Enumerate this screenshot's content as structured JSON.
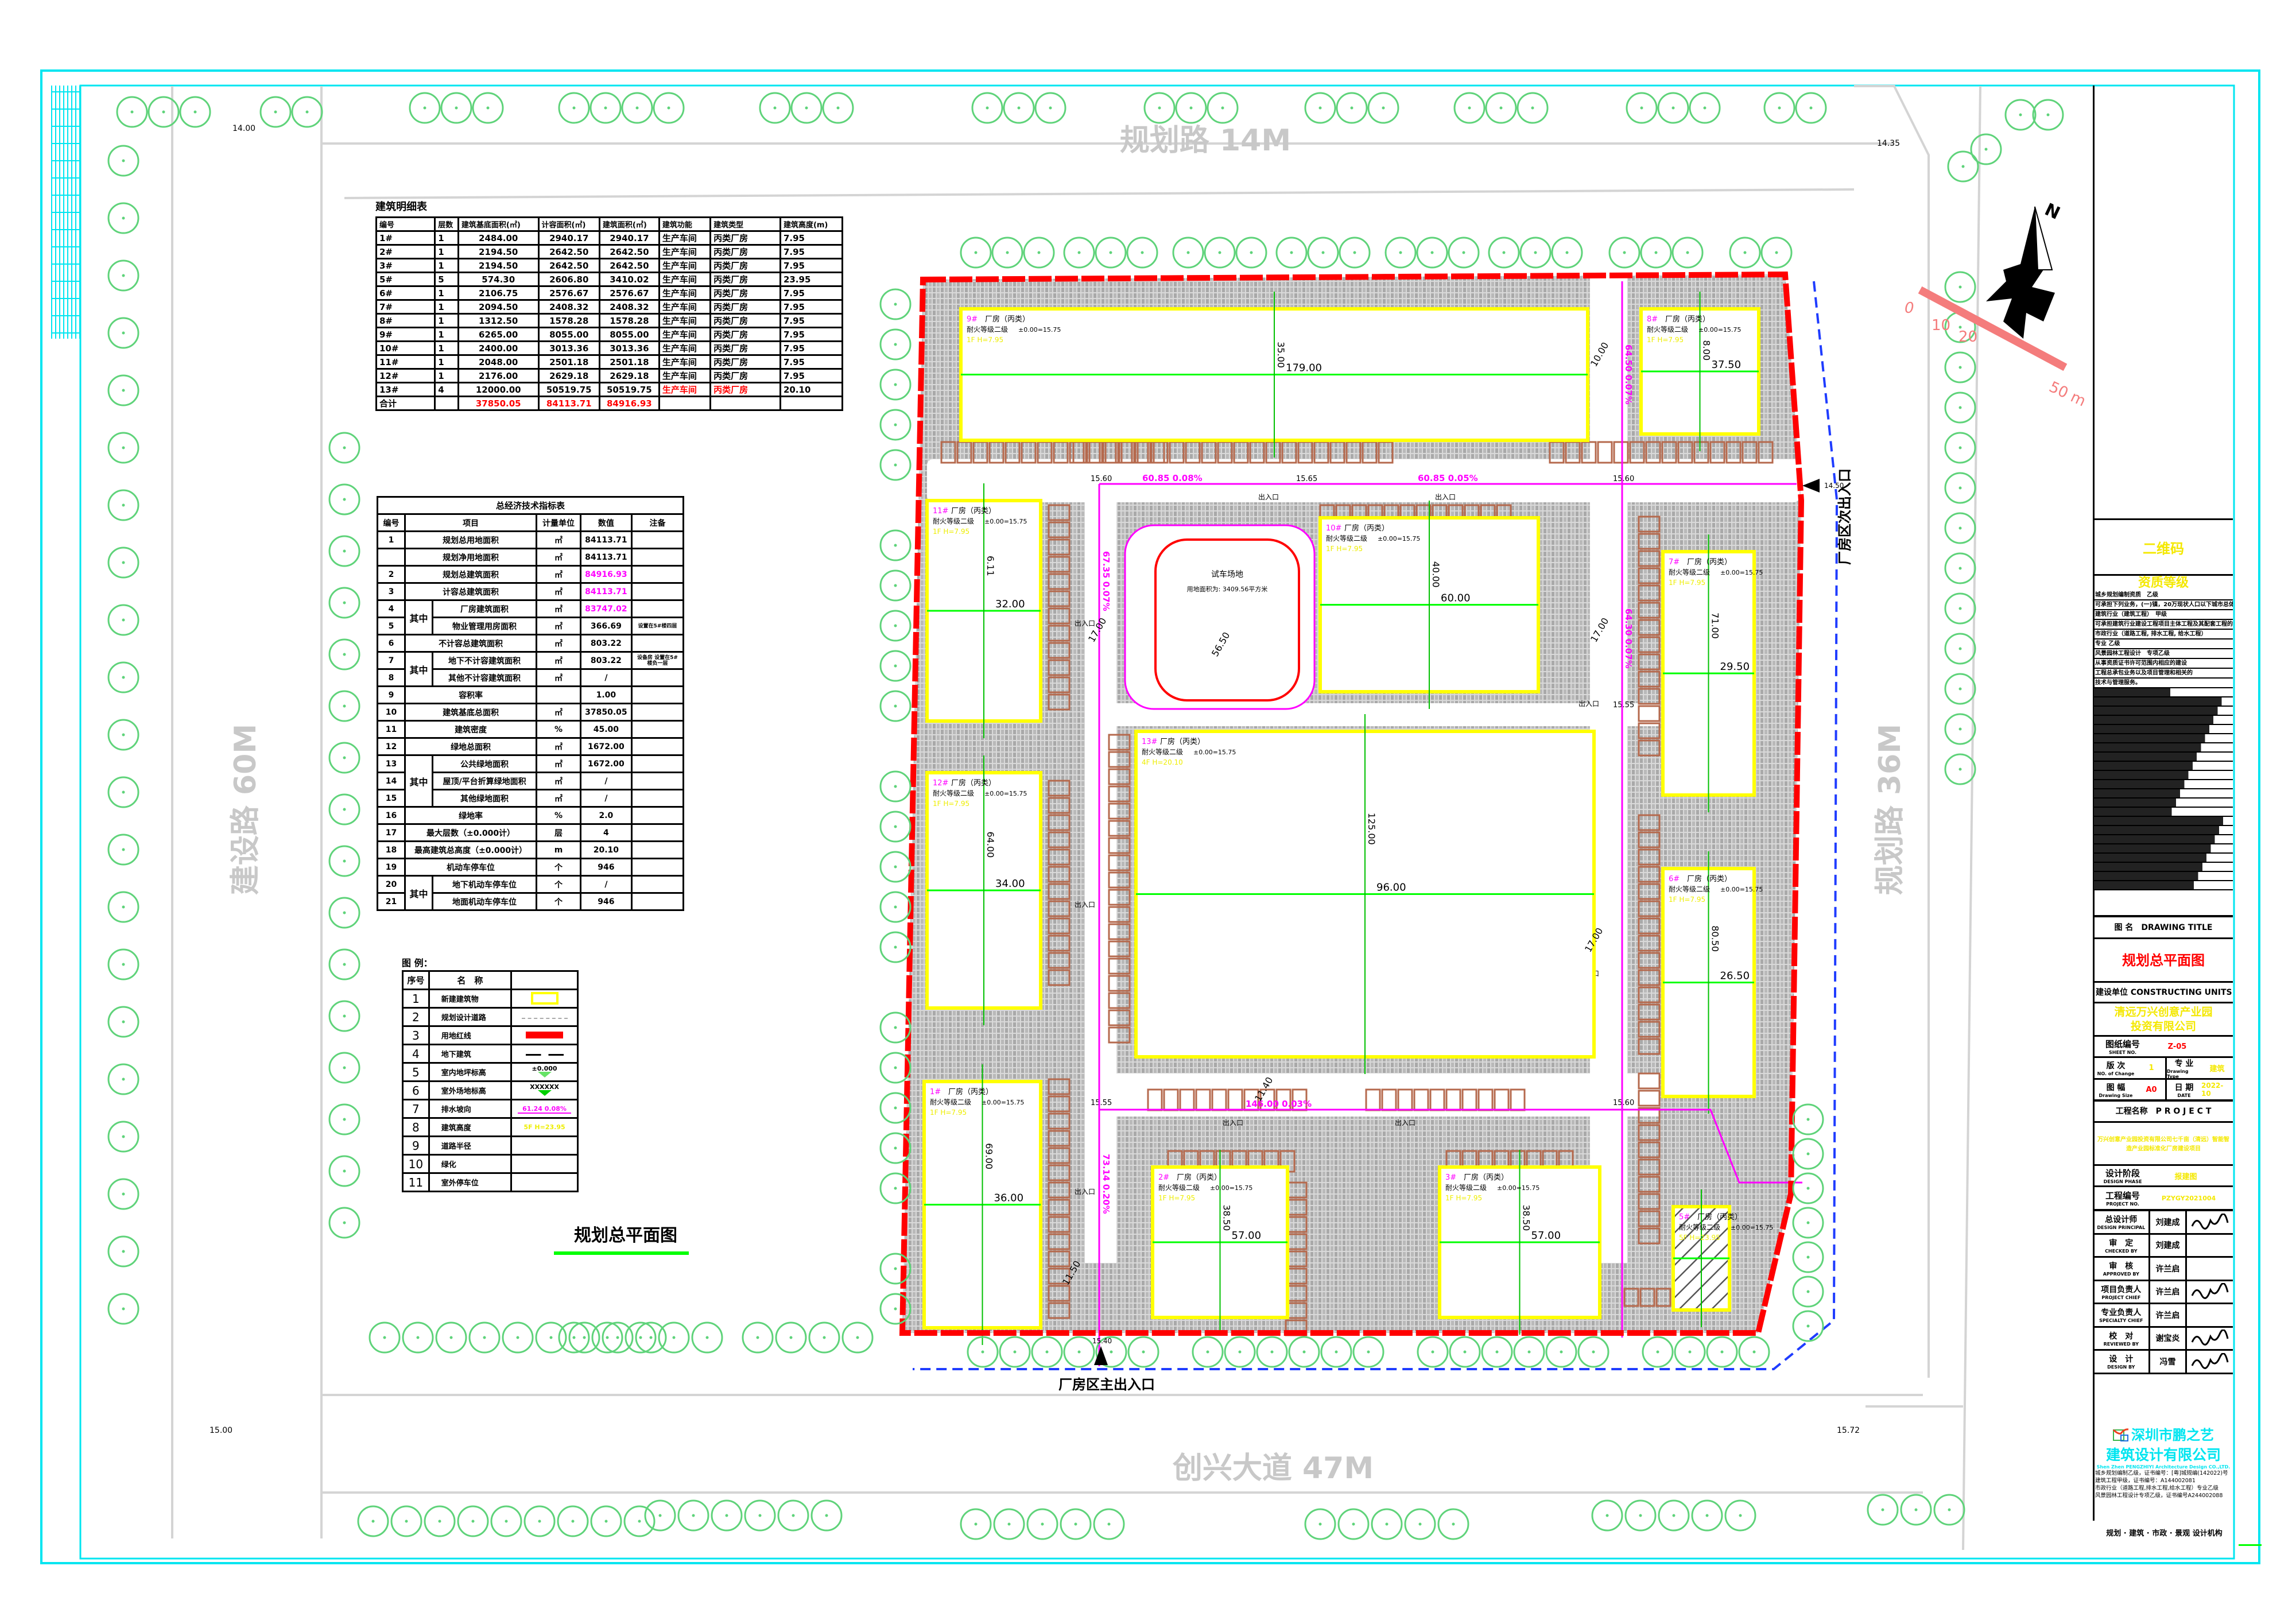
{
  "roads": {
    "north": "规划路 14M",
    "west": "建设路 60M",
    "east": "规划路 36M",
    "south": "创兴大道 47M"
  },
  "elevations": {
    "nw": "14.00",
    "ne": "14.35",
    "sw": "15.00",
    "se": "15.72",
    "gate_main": "15.40",
    "gate_side": "14.50",
    "internal": [
      "15.60",
      "15.65",
      "15.60",
      "15.55",
      "15.60",
      "15.55",
      "15.65"
    ]
  },
  "entrances": {
    "main": "厂房区主出入口",
    "side": "厂房区次出入口",
    "gate": "出入口"
  },
  "site": {
    "test_track_title": "试车场地",
    "test_track_area": "用地面积为: 3409.56平方米",
    "buildings": [
      {
        "id": "9#",
        "label": "厂房（丙类）",
        "fire": "耐火等级二级",
        "level": "±0.00=15.75",
        "height": "1F H=7.95",
        "dim_long": "179.00",
        "dim_short": "35.00"
      },
      {
        "id": "8#",
        "label": "厂房（丙类）",
        "fire": "耐火等级二级",
        "level": "±0.00=15.75",
        "height": "1F H=7.95",
        "dim_long": "37.50",
        "dim_short": "8.00"
      },
      {
        "id": "11#",
        "label": "厂房（丙类）",
        "fire": "耐火等级二级",
        "level": "±0.00=15.75",
        "height": "1F H=7.95",
        "dim_long": "32.00",
        "dim_short": "6.11"
      },
      {
        "id": "10#",
        "label": "厂房（丙类）",
        "fire": "耐火等级二级",
        "level": "±0.00=15.75",
        "height": "1F H=7.95",
        "dim_long": "60.00",
        "dim_short": "40.00"
      },
      {
        "id": "7#",
        "label": "厂房（丙类）",
        "fire": "耐火等级二级",
        "level": "±0.00=15.75",
        "height": "1F H=7.95",
        "dim_long": "29.50",
        "dim_short": "71.00"
      },
      {
        "id": "13#",
        "label": "厂房（丙类）",
        "fire": "耐火等级二级",
        "level": "±0.00=15.75",
        "height": "4F H=20.10",
        "dim_long": "96.00",
        "dim_short": "125.00"
      },
      {
        "id": "12#",
        "label": "厂房（丙类）",
        "fire": "耐火等级二级",
        "level": "±0.00=15.75",
        "height": "1F H=7.95",
        "dim_long": "34.00",
        "dim_short": "64.00"
      },
      {
        "id": "6#",
        "label": "厂房（丙类）",
        "fire": "耐火等级二级",
        "level": "±0.00=15.75",
        "height": "1F H=7.95",
        "dim_long": "26.50",
        "dim_short": "80.50"
      },
      {
        "id": "1#",
        "label": "厂房（丙类）",
        "fire": "耐火等级二级",
        "level": "±0.00=15.75",
        "height": "1F H=7.95",
        "dim_long": "36.00",
        "dim_short": "69.00"
      },
      {
        "id": "2#",
        "label": "厂房（丙类）",
        "fire": "耐火等级二级",
        "level": "±0.00=15.75",
        "height": "1F H=7.95",
        "dim_long": "57.00",
        "dim_short": "38.50"
      },
      {
        "id": "3#",
        "label": "厂房（丙类）",
        "fire": "耐火等级二级",
        "level": "±0.00=15.75",
        "height": "1F H=7.95",
        "dim_long": "57.00",
        "dim_short": "38.50"
      },
      {
        "id": "5#",
        "label": "厂房（丙类）",
        "fire": "耐火等级二级",
        "level": "±0.00=15.75",
        "height": "5F H=23.95",
        "dim_long": "",
        "dim_short": ""
      }
    ],
    "slopes": [
      "60.85 0.08%",
      "60.85 0.05%",
      "64.50 0.07%",
      "67.35 0.07%",
      "64.30 0.07%",
      "146.00 0.03%",
      "73.14 0.20%"
    ],
    "road_dims": [
      "17.00",
      "17.00",
      "56.50",
      "17.00",
      "10.00",
      "11.40",
      "11.50"
    ]
  },
  "compass": {
    "north": "N",
    "scale": [
      "0",
      "10",
      "20",
      "50 m"
    ]
  },
  "building_table": {
    "title": "建筑明细表",
    "headers": [
      "编号",
      "层数",
      "建筑基底面积(㎡)",
      "计容面积(㎡)",
      "建筑面积(㎡)",
      "建筑功能",
      "建筑类型",
      "建筑高度(m)"
    ],
    "rows": [
      [
        "1#",
        "1",
        "2484.00",
        "2940.17",
        "2940.17",
        "生产车间",
        "丙类厂房",
        "7.95"
      ],
      [
        "2#",
        "1",
        "2194.50",
        "2642.50",
        "2642.50",
        "生产车间",
        "丙类厂房",
        "7.95"
      ],
      [
        "3#",
        "1",
        "2194.50",
        "2642.50",
        "2642.50",
        "生产车间",
        "丙类厂房",
        "7.95"
      ],
      [
        "5#",
        "5",
        "574.30",
        "2606.80",
        "3410.02",
        "生产车间",
        "丙类厂房",
        "23.95"
      ],
      [
        "6#",
        "1",
        "2106.75",
        "2576.67",
        "2576.67",
        "生产车间",
        "丙类厂房",
        "7.95"
      ],
      [
        "7#",
        "1",
        "2094.50",
        "2408.32",
        "2408.32",
        "生产车间",
        "丙类厂房",
        "7.95"
      ],
      [
        "8#",
        "1",
        "1312.50",
        "1578.28",
        "1578.28",
        "生产车间",
        "丙类厂房",
        "7.95"
      ],
      [
        "9#",
        "1",
        "6265.00",
        "8055.00",
        "8055.00",
        "生产车间",
        "丙类厂房",
        "7.95"
      ],
      [
        "10#",
        "1",
        "2400.00",
        "3013.36",
        "3013.36",
        "生产车间",
        "丙类厂房",
        "7.95"
      ],
      [
        "11#",
        "1",
        "2048.00",
        "2501.18",
        "2501.18",
        "生产车间",
        "丙类厂房",
        "7.95"
      ],
      [
        "12#",
        "1",
        "2176.00",
        "2629.18",
        "2629.18",
        "生产车间",
        "丙类厂房",
        "7.95"
      ],
      [
        "13#",
        "4",
        "12000.00",
        "50519.75",
        "50519.75",
        "生产车间",
        "丙类厂房",
        "20.10"
      ]
    ],
    "highlight_row": "13#",
    "total": [
      "合计",
      "",
      "37850.05",
      "84113.71",
      "84916.93",
      "",
      "",
      ""
    ]
  },
  "tech_table": {
    "title": "总经济技术指标表",
    "headers": [
      "编号",
      "项目",
      "计量单位",
      "数值",
      "注备"
    ],
    "sub_label": "其中",
    "rows": [
      {
        "no": "1",
        "item": "规划总用地面积",
        "unit": "㎡",
        "value": "84113.71",
        "note": ""
      },
      {
        "no": "",
        "item": "规划净用地面积",
        "unit": "㎡",
        "value": "84113.71",
        "note": ""
      },
      {
        "no": "2",
        "item": "规划总建筑面积",
        "unit": "㎡",
        "value": "84916.93",
        "note": "",
        "highlight": true
      },
      {
        "no": "3",
        "item": "计容总建筑面积",
        "unit": "㎡",
        "value": "84113.71",
        "note": "",
        "highlight": true
      },
      {
        "no": "4",
        "item": "厂房建筑面积",
        "unit": "㎡",
        "value": "83747.02",
        "note": "",
        "sub": true,
        "highlight": true
      },
      {
        "no": "5",
        "item": "物业管理用房面积",
        "unit": "㎡",
        "value": "366.69",
        "note": "设置在5#楼四层",
        "sub": true
      },
      {
        "no": "6",
        "item": "不计容总建筑面积",
        "unit": "㎡",
        "value": "803.22",
        "note": ""
      },
      {
        "no": "7",
        "item": "地下不计容建筑面积",
        "unit": "㎡",
        "value": "803.22",
        "note": "设备房 设置在5#楼负一层",
        "sub": true
      },
      {
        "no": "8",
        "item": "其他不计容建筑面积",
        "unit": "㎡",
        "value": "/",
        "note": "",
        "sub": true
      },
      {
        "no": "9",
        "item": "容积率",
        "unit": "",
        "value": "1.00",
        "note": ""
      },
      {
        "no": "10",
        "item": "建筑基底总面积",
        "unit": "㎡",
        "value": "37850.05",
        "note": ""
      },
      {
        "no": "11",
        "item": "建筑密度",
        "unit": "%",
        "value": "45.00",
        "note": ""
      },
      {
        "no": "12",
        "item": "绿地总面积",
        "unit": "㎡",
        "value": "1672.00",
        "note": ""
      },
      {
        "no": "13",
        "item": "公共绿地面积",
        "unit": "㎡",
        "value": "1672.00",
        "note": "",
        "sub": true
      },
      {
        "no": "14",
        "item": "屋顶/平台折算绿地面积",
        "unit": "㎡",
        "value": "/",
        "note": "",
        "sub": true
      },
      {
        "no": "15",
        "item": "其他绿地面积",
        "unit": "㎡",
        "value": "/",
        "note": "",
        "sub": true
      },
      {
        "no": "16",
        "item": "绿地率",
        "unit": "%",
        "value": "2.0",
        "note": ""
      },
      {
        "no": "17",
        "item": "最大层数（±0.000计）",
        "unit": "层",
        "value": "4",
        "note": ""
      },
      {
        "no": "18",
        "item": "最高建筑总高度（±0.000计）",
        "unit": "m",
        "value": "20.10",
        "note": ""
      },
      {
        "no": "19",
        "item": "机动车停车位",
        "unit": "个",
        "value": "946",
        "note": ""
      },
      {
        "no": "20",
        "item": "地下机动车停车位",
        "unit": "个",
        "value": "/",
        "note": "",
        "sub": true
      },
      {
        "no": "21",
        "item": "地面机动车停车位",
        "unit": "个",
        "value": "946",
        "note": "",
        "sub": true
      }
    ]
  },
  "legend": {
    "title": "图 例：",
    "headers": [
      "序号",
      "名　称",
      ""
    ],
    "items": [
      {
        "no": "1",
        "name": "新建建筑物",
        "symbol": "yellow-box"
      },
      {
        "no": "2",
        "name": "规划设计道路",
        "symbol": "gray-dashed-line"
      },
      {
        "no": "3",
        "name": "用地红线",
        "symbol": "red-bar"
      },
      {
        "no": "4",
        "name": "地下建筑",
        "symbol": "black-dashed-line"
      },
      {
        "no": "5",
        "name": "室内地坪标高",
        "symbol": "hollow-triangle",
        "text": "±0.000"
      },
      {
        "no": "6",
        "name": "室外场地标高",
        "symbol": "filled-triangle",
        "text": "XXXXXX"
      },
      {
        "no": "7",
        "name": "排水坡向",
        "symbol": "magenta-line",
        "text": "61.24 0.08%"
      },
      {
        "no": "8",
        "name": "建筑高度",
        "symbol": "yellow-text",
        "text": "5F H=23.95"
      },
      {
        "no": "9",
        "name": "道路半径",
        "symbol": ""
      },
      {
        "no": "10",
        "name": "绿化",
        "symbol": ""
      },
      {
        "no": "11",
        "name": "室外停车位",
        "symbol": ""
      }
    ]
  },
  "drawing_caption": "规划总平面图",
  "title_block": {
    "qr": "二维码",
    "qual_title": "资质等级",
    "qual_lines": [
      "城乡规划编制资质　乙级",
      "可承担下列业务，(一)镇，20万现状人口以下城市总体规划的编制；",
      "建筑行业（建筑工程）　甲级",
      "可承担建筑行业建设工程项目主体工程及其配套工程的设计业务；",
      "市政行业（道路工程, 排水工程, 给水工程）",
      "专业 乙级",
      "风景园林工程设计　专项乙级",
      "从事资质证书许可范围内相应的建设",
      "工程总承包业务以及项目管理和相关的",
      "技术与管理服务。"
    ],
    "drawing_title_label": "图 名",
    "drawing_title_en": "DRAWING TITLE",
    "drawing_title": "规划总平面图",
    "client_label": "建设单位",
    "client_label_en": "CONSTRUCTING UNITS",
    "client": "清远万兴创意产业园投资有限公司",
    "sheet_no_label": "图纸编号",
    "sheet_no_en": "SHEET NO.",
    "sheet_no": "Z-05",
    "revision_label": "版 次",
    "revision_en": "NO. of Change",
    "revision": "1",
    "discipline_label": "专 业",
    "discipline_en": "Drawing Type",
    "discipline": "建筑",
    "size_label": "图 幅",
    "size_en": "Drawing Size",
    "size": "A0",
    "date_label": "日 期",
    "date_en": "DATE",
    "date": "2022-10",
    "project_label": "工程名称",
    "project_label_en": "P R O J E C T",
    "project": "万兴创意产业园投资有限公司七千亩（清远）智能智造产业园标准化厂房建设项目",
    "phase_label": "设计阶段",
    "phase_en": "DESIGN PHASE",
    "phase": "报建图",
    "project_no_label": "工程编号",
    "project_no_en": "PROJECT NO.",
    "project_no": "PZYGY2021004",
    "signatures": [
      {
        "role": "总设计师",
        "role_en": "DESIGN PRINCIPAL",
        "name": "刘建成",
        "signed": true
      },
      {
        "role": "审　定",
        "role_en": "CHECKED BY",
        "name": "刘建成",
        "signed": false
      },
      {
        "role": "审　核",
        "role_en": "APPROVED BY",
        "name": "许兰启",
        "signed": false
      },
      {
        "role": "项目负责人",
        "role_en": "PROJECT CHIEF",
        "name": "许兰启",
        "signed": true
      },
      {
        "role": "专业负责人",
        "role_en": "SPECIALTY CHIEF",
        "name": "许兰启",
        "signed": false
      },
      {
        "role": "校　对",
        "role_en": "REVIEWED BY",
        "name": "谢宝炎",
        "signed": true
      },
      {
        "role": "设　计",
        "role_en": "DESIGN BY",
        "name": "冯雪",
        "signed": true
      }
    ],
    "firm_line1": "深圳市鹏之艺",
    "firm_line2": "建筑设计有限公司",
    "firm_en": "Shen Zhen PENGZHIYI Architecture Design CO.,LTD.",
    "firm_certs": [
      "城乡规划编制乙级，证书编号：[粤]城规编(142022)号",
      "建筑工程甲级，证书编号：A144002081",
      "市政行业（道路工程,排水工程,给水工程）专业乙级",
      "风景园林工程设计专项乙级，证书编号A244002088"
    ],
    "footer": "规划 · 建筑 · 市政 · 景观 设计机构"
  },
  "colors": {
    "frame": "#00e5f0",
    "red_line": "#ff0000",
    "building": "#ffff00",
    "tree": "#5fd37a",
    "dimension": "#00ff00",
    "slope": "#ff00ff",
    "parking": "#b5694d",
    "paving": "#bdbdbd"
  }
}
